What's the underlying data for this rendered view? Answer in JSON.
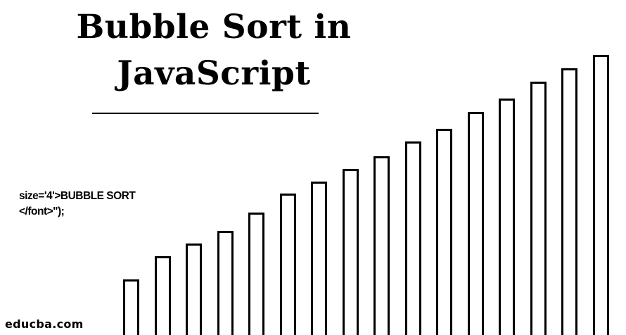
{
  "title": {
    "line1": "Bubble Sort in",
    "line2": "JavaScript"
  },
  "code_snippet": {
    "line1": "size='4'>BUBBLE SORT",
    "line2": "</font>\");"
  },
  "watermark": "educba.com",
  "chart_data": {
    "type": "bar",
    "title": "",
    "xlabel": "",
    "ylabel": "",
    "categories": [
      "",
      "",
      "",
      "",
      "",
      "",
      "",
      "",
      "",
      "",
      "",
      "",
      "",
      "",
      "",
      ""
    ],
    "values": [
      83,
      117,
      136,
      155,
      182,
      210,
      228,
      247,
      266,
      287,
      306,
      331,
      351,
      376,
      396,
      416
    ],
    "ylim": [
      0,
      416
    ],
    "axes_visible": false,
    "grid": false,
    "bar_fill": "#ffffff",
    "bar_stroke": "#000000"
  }
}
